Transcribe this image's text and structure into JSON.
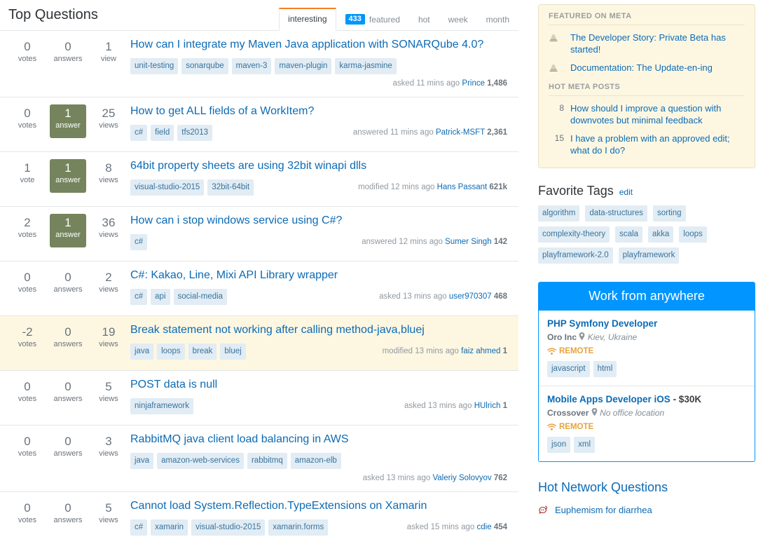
{
  "header": {
    "title": "Top Questions",
    "tabs": [
      {
        "label": "interesting",
        "selected": true,
        "count": null
      },
      {
        "label": "featured",
        "selected": false,
        "count": "433"
      },
      {
        "label": "hot",
        "selected": false,
        "count": null
      },
      {
        "label": "week",
        "selected": false,
        "count": null
      },
      {
        "label": "month",
        "selected": false,
        "count": null
      }
    ]
  },
  "questions": [
    {
      "votes": "0",
      "votes_label": "votes",
      "answers": "0",
      "answers_label": "answers",
      "answered": false,
      "views": "1",
      "views_label": "view",
      "title": "How can I integrate my Maven Java application with SONARQube 4.0?",
      "tags": [
        "unit-testing",
        "sonarqube",
        "maven-3",
        "maven-plugin",
        "karma-jasmine"
      ],
      "action": "asked",
      "time": "11 mins ago",
      "user": "Prince",
      "rep": "1,486",
      "highlight": false,
      "stacked": true
    },
    {
      "votes": "0",
      "votes_label": "votes",
      "answers": "1",
      "answers_label": "answer",
      "answered": true,
      "views": "25",
      "views_label": "views",
      "title": "How to get ALL fields of a WorkItem?",
      "tags": [
        "c#",
        "field",
        "tfs2013"
      ],
      "action": "answered",
      "time": "11 mins ago",
      "user": "Patrick-MSFT",
      "rep": "2,361",
      "highlight": false,
      "stacked": false
    },
    {
      "votes": "1",
      "votes_label": "vote",
      "answers": "1",
      "answers_label": "answer",
      "answered": true,
      "views": "8",
      "views_label": "views",
      "title": "64bit property sheets are using 32bit winapi dlls",
      "tags": [
        "visual-studio-2015",
        "32bit-64bit"
      ],
      "action": "modified",
      "time": "12 mins ago",
      "user": "Hans Passant",
      "rep": "621k",
      "highlight": false,
      "stacked": false
    },
    {
      "votes": "2",
      "votes_label": "votes",
      "answers": "1",
      "answers_label": "answer",
      "answered": true,
      "views": "36",
      "views_label": "views",
      "title": "How can i stop windows service using C#?",
      "tags": [
        "c#"
      ],
      "action": "answered",
      "time": "12 mins ago",
      "user": "Sumer Singh",
      "rep": "142",
      "highlight": false,
      "stacked": false
    },
    {
      "votes": "0",
      "votes_label": "votes",
      "answers": "0",
      "answers_label": "answers",
      "answered": false,
      "views": "2",
      "views_label": "views",
      "title": "C#: Kakao, Line, Mixi API Library wrapper",
      "tags": [
        "c#",
        "api",
        "social-media"
      ],
      "action": "asked",
      "time": "13 mins ago",
      "user": "user970307",
      "rep": "468",
      "highlight": false,
      "stacked": false
    },
    {
      "votes": "-2",
      "votes_label": "votes",
      "answers": "0",
      "answers_label": "answers",
      "answered": false,
      "views": "19",
      "views_label": "views",
      "title": "Break statement not working after calling method-java,bluej",
      "tags": [
        "java",
        "loops",
        "break",
        "bluej"
      ],
      "action": "modified",
      "time": "13 mins ago",
      "user": "faiz ahmed",
      "rep": "1",
      "highlight": true,
      "stacked": false
    },
    {
      "votes": "0",
      "votes_label": "votes",
      "answers": "0",
      "answers_label": "answers",
      "answered": false,
      "views": "5",
      "views_label": "views",
      "title": "POST data is null",
      "tags": [
        "ninjaframework"
      ],
      "action": "asked",
      "time": "13 mins ago",
      "user": "HUlrich",
      "rep": "1",
      "highlight": false,
      "stacked": false
    },
    {
      "votes": "0",
      "votes_label": "votes",
      "answers": "0",
      "answers_label": "answers",
      "answered": false,
      "views": "3",
      "views_label": "views",
      "title": "RabbitMQ java client load balancing in AWS",
      "tags": [
        "java",
        "amazon-web-services",
        "rabbitmq",
        "amazon-elb"
      ],
      "action": "asked",
      "time": "13 mins ago",
      "user": "Valeriy Solovyov",
      "rep": "762",
      "highlight": false,
      "stacked": true
    },
    {
      "votes": "0",
      "votes_label": "votes",
      "answers": "0",
      "answers_label": "answers",
      "answered": false,
      "views": "5",
      "views_label": "views",
      "title": "Cannot load System.Reflection.TypeExtensions on Xamarin",
      "tags": [
        "c#",
        "xamarin",
        "visual-studio-2015",
        "xamarin.forms"
      ],
      "action": "asked",
      "time": "15 mins ago",
      "user": "cdie",
      "rep": "454",
      "highlight": false,
      "stacked": false
    }
  ],
  "sidebar": {
    "bulletin": {
      "featured_heading": "FEATURED ON META",
      "featured_items": [
        {
          "text": "The Developer Story: Private Beta has started!"
        },
        {
          "text": "Documentation: The Update-en-ing"
        }
      ],
      "hot_heading": "HOT META POSTS",
      "hot_items": [
        {
          "votes": "8",
          "text": "How should I improve a question with downvotes but minimal feedback"
        },
        {
          "votes": "15",
          "text": "I have a problem with an approved edit; what do I do?"
        }
      ]
    },
    "favorite_tags": {
      "title": "Favorite Tags",
      "edit_label": "edit",
      "tags": [
        "algorithm",
        "data-structures",
        "sorting",
        "complexity-theory",
        "scala",
        "akka",
        "loops",
        "playframework-2.0",
        "playframework"
      ]
    },
    "jobs": {
      "heading": "Work from anywhere",
      "remote_label": "REMOTE",
      "items": [
        {
          "title": "PHP Symfony Developer",
          "salary": "",
          "company": "Oro Inc",
          "location": "Kiev, Ukraine",
          "tags": [
            "javascript",
            "html"
          ]
        },
        {
          "title": "Mobile Apps Developer iOS",
          "salary": "- $30K",
          "company": "Crossover",
          "location": "No office location",
          "tags": [
            "json",
            "xml"
          ]
        }
      ]
    },
    "hot_network": {
      "title": "Hot Network Questions",
      "items": [
        {
          "text": "Euphemism for diarrhea"
        }
      ]
    }
  },
  "colors": {
    "accent_orange": "#f48024",
    "link_blue": "#0c6bb5",
    "badge_blue": "#0095ff",
    "answered_green": "#75845c",
    "tag_bg": "#e1ecf4",
    "tag_fg": "#39739d",
    "highlight_bg": "#fdf7e2",
    "remote_gold": "#e8a33d"
  }
}
